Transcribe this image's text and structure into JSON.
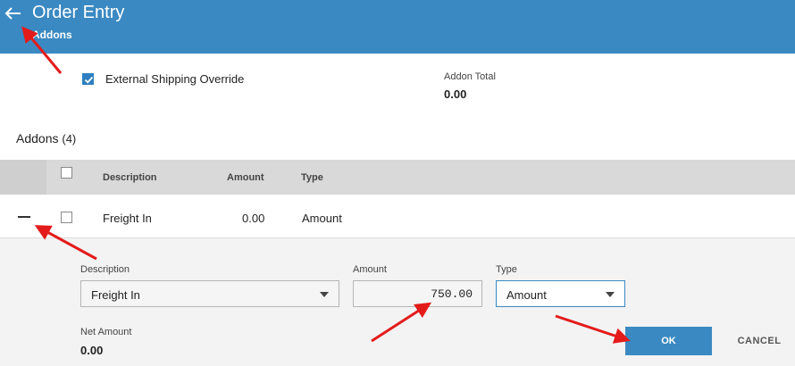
{
  "header": {
    "title": "Order Entry",
    "subtitle": "Addons",
    "back_icon": "arrow-left-icon",
    "color": "#3a89c2"
  },
  "form": {
    "external_shipping_override": {
      "label": "External Shipping Override",
      "checked": true
    },
    "addon_total": {
      "label": "Addon Total",
      "value": "0.00"
    }
  },
  "addons_section": {
    "title": "Addons",
    "count": "(4)"
  },
  "table": {
    "columns": [
      "Description",
      "Amount",
      "Type"
    ],
    "rows": [
      {
        "description": "Freight In",
        "amount": "0.00",
        "type": "Amount",
        "expanded": true
      }
    ]
  },
  "detail": {
    "description": {
      "label": "Description",
      "value": "Freight In"
    },
    "amount": {
      "label": "Amount",
      "value": "750.00"
    },
    "type": {
      "label": "Type",
      "value": "Amount"
    },
    "net_amount": {
      "label": "Net Amount",
      "value": "0.00"
    }
  },
  "actions": {
    "ok_label": "OK",
    "cancel_label": "CANCEL"
  },
  "annotation_color": "#e41b1b"
}
